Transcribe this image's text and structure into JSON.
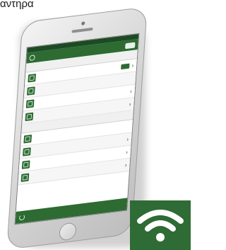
{
  "page": {
    "caption": "αντηρα"
  },
  "colors": {
    "brand_green": "#2d6b33",
    "badge_green": "#2f6b35"
  },
  "phone": {
    "statusbar": {
      "left": "",
      "right": ""
    },
    "navbar": {
      "title": ""
    },
    "groups": [
      {
        "header": "",
        "rows": [
          {
            "label": "",
            "value": "",
            "icon": "settings-icon",
            "has_indicator": true
          },
          {
            "label": "",
            "value": "",
            "icon": "device-icon"
          },
          {
            "label": "",
            "value": "",
            "icon": "device-icon"
          },
          {
            "label": "",
            "value": "",
            "icon": "device-icon"
          }
        ]
      },
      {
        "header": "",
        "rows": [
          {
            "label": "",
            "value": "",
            "icon": "device-icon"
          },
          {
            "label": "",
            "value": "",
            "icon": "device-icon"
          },
          {
            "label": "",
            "value": "",
            "icon": "device-icon"
          },
          {
            "label": "",
            "value": "",
            "icon": "device-icon"
          }
        ]
      }
    ],
    "bottom_bar": {
      "label": "",
      "icon": "refresh-icon"
    }
  },
  "badge": {
    "icon": "wifi-icon"
  }
}
